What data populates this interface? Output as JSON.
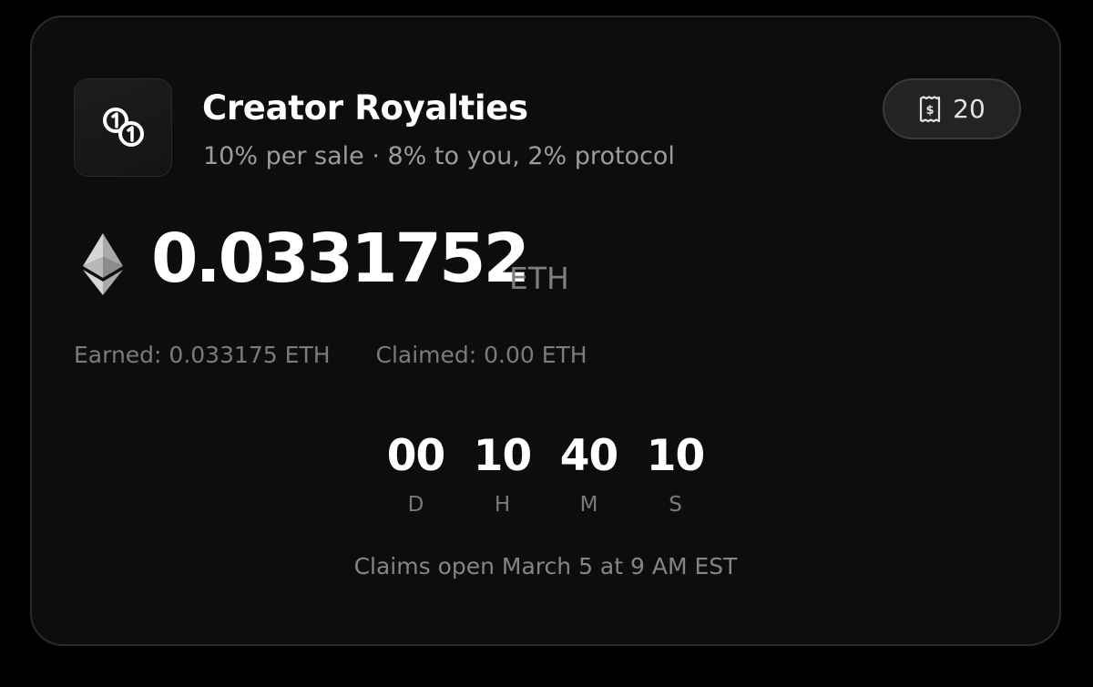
{
  "card": {
    "icon": "coins-icon",
    "title": "Creator Royalties",
    "subtitle": "10% per sale · 8% to you, 2% protocol"
  },
  "badge": {
    "icon": "receipt-icon",
    "count": "20"
  },
  "balance": {
    "icon": "ethereum-icon",
    "amount": "0.0331752",
    "unit": "ETH"
  },
  "stats": {
    "earned": "Earned: 0.033175 ETH",
    "claimed": "Claimed: 0.00 ETH"
  },
  "countdown": {
    "units": [
      {
        "value": "00",
        "label": "D"
      },
      {
        "value": "10",
        "label": "H"
      },
      {
        "value": "40",
        "label": "M"
      },
      {
        "value": "10",
        "label": "S"
      }
    ]
  },
  "claim_note": "Claims open March 5 at 9 AM EST",
  "colors": {
    "background": "#000000",
    "card": "#0d0d0d",
    "primary_text": "#ffffff",
    "muted_text": "#7b7b7b"
  }
}
